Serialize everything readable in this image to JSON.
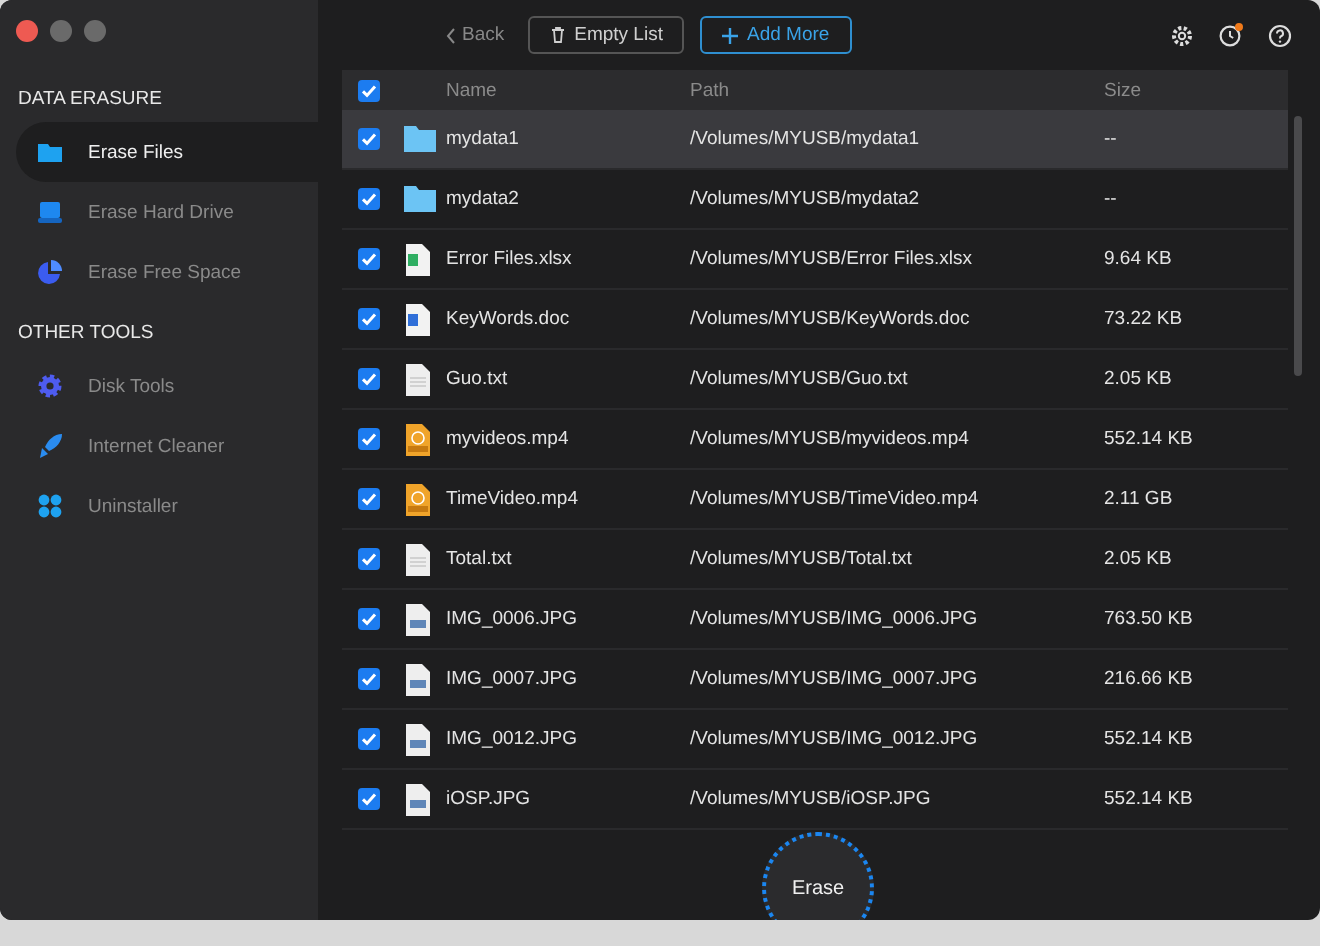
{
  "toolbar": {
    "back": "Back",
    "empty": "Empty List",
    "add": "Add More"
  },
  "sidebar": [
    {
      "heading": "DATA ERASURE",
      "items": [
        {
          "label": "Erase Files",
          "kind": "folder",
          "selected": true
        },
        {
          "label": "Erase Hard Drive",
          "kind": "drive",
          "selected": false
        },
        {
          "label": "Erase Free Space",
          "kind": "pie",
          "selected": false
        }
      ]
    },
    {
      "heading": "OTHER TOOLS",
      "items": [
        {
          "label": "Disk Tools",
          "kind": "gear",
          "selected": false
        },
        {
          "label": "Internet Cleaner",
          "kind": "rocket",
          "selected": false
        },
        {
          "label": "Uninstaller",
          "kind": "apps",
          "selected": false
        }
      ]
    }
  ],
  "table": {
    "columns": [
      "Name",
      "Path",
      "Size"
    ],
    "all_checked": true,
    "rows": [
      {
        "kind": "folder",
        "name": "mydata1",
        "path": "/Volumes/MYUSB/mydata1",
        "size": "--",
        "checked": true,
        "selected": true
      },
      {
        "kind": "folder",
        "name": "mydata2",
        "path": "/Volumes/MYUSB/mydata2",
        "size": "--",
        "checked": true,
        "selected": false
      },
      {
        "kind": "sheet",
        "name": "Error Files.xlsx",
        "path": "/Volumes/MYUSB/Error Files.xlsx",
        "size": "9.64 KB",
        "checked": true,
        "selected": false
      },
      {
        "kind": "doc",
        "name": "KeyWords.doc",
        "path": "/Volumes/MYUSB/KeyWords.doc",
        "size": "73.22 KB",
        "checked": true,
        "selected": false
      },
      {
        "kind": "text",
        "name": "Guo.txt",
        "path": "/Volumes/MYUSB/Guo.txt",
        "size": "2.05 KB",
        "checked": true,
        "selected": false
      },
      {
        "kind": "video",
        "name": "myvideos.mp4",
        "path": "/Volumes/MYUSB/myvideos.mp4",
        "size": "552.14 KB",
        "checked": true,
        "selected": false
      },
      {
        "kind": "video",
        "name": "TimeVideo.mp4",
        "path": "/Volumes/MYUSB/TimeVideo.mp4",
        "size": "2.11 GB",
        "checked": true,
        "selected": false
      },
      {
        "kind": "text",
        "name": "Total.txt",
        "path": "/Volumes/MYUSB/Total.txt",
        "size": "2.05 KB",
        "checked": true,
        "selected": false
      },
      {
        "kind": "image",
        "name": "IMG_0006.JPG",
        "path": "/Volumes/MYUSB/IMG_0006.JPG",
        "size": "763.50 KB",
        "checked": true,
        "selected": false
      },
      {
        "kind": "image",
        "name": "IMG_0007.JPG",
        "path": "/Volumes/MYUSB/IMG_0007.JPG",
        "size": "216.66 KB",
        "checked": true,
        "selected": false
      },
      {
        "kind": "image",
        "name": "IMG_0012.JPG",
        "path": "/Volumes/MYUSB/IMG_0012.JPG",
        "size": "552.14 KB",
        "checked": true,
        "selected": false
      },
      {
        "kind": "image",
        "name": "iOSP.JPG",
        "path": "/Volumes/MYUSB/iOSP.JPG",
        "size": "552.14 KB",
        "checked": true,
        "selected": false
      }
    ]
  },
  "erase": "Erase",
  "history_badge": true
}
